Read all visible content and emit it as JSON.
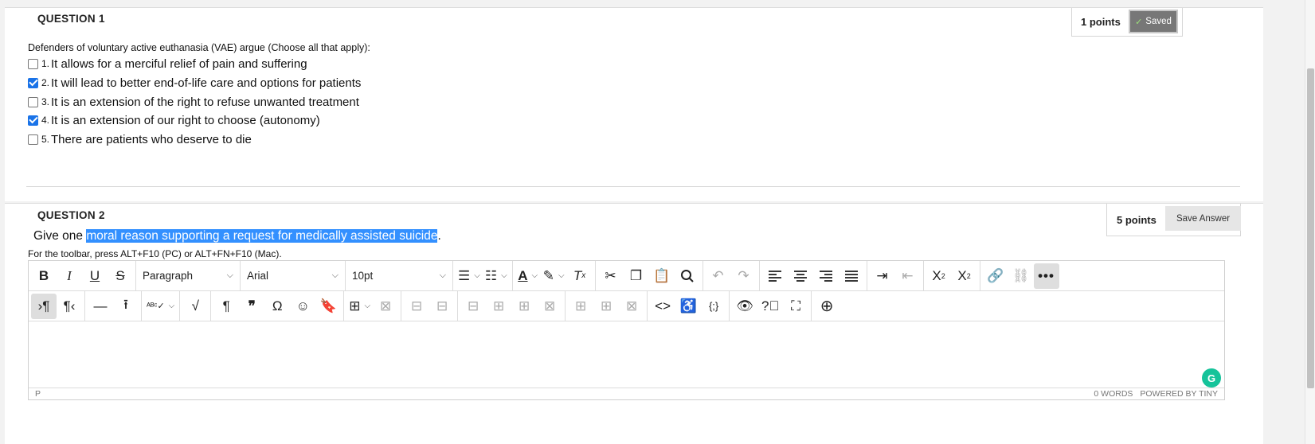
{
  "question1": {
    "title": "QUESTION 1",
    "points": "1 points",
    "saved_label": "Saved",
    "prompt": "Defenders of voluntary active euthanasia (VAE) argue (Choose all that apply):",
    "options": [
      {
        "num": "1.",
        "text": "It allows for a merciful relief of pain and suffering",
        "checked": false
      },
      {
        "num": "2.",
        "text": "It will lead to better end-of-life care and options for patients",
        "checked": true
      },
      {
        "num": "3.",
        "text": "It is an extension of the right to refuse unwanted treatment",
        "checked": false
      },
      {
        "num": "4.",
        "text": "It is an extension of our right to choose (autonomy)",
        "checked": true
      },
      {
        "num": "5.",
        "text": "There are patients who deserve to die",
        "checked": false
      }
    ]
  },
  "question2": {
    "title": "QUESTION 2",
    "points": "5 points",
    "save_label": "Save Answer",
    "text_plain": "Give one ",
    "text_selected": "moral reason supporting a request for medically assisted suicide",
    "text_after": ".",
    "toolbar_hint": "For the toolbar, press ALT+F10 (PC) or ALT+FN+F10 (Mac)."
  },
  "editor": {
    "block_format": "Paragraph",
    "font_family": "Arial",
    "font_size": "10pt",
    "status_path": "P",
    "word_count": "0 WORDS",
    "powered_by": "POWERED BY TINY",
    "grammarly_letter": "G"
  },
  "colors": {
    "selection": "#3390ff",
    "checkbox": "#1a73e8",
    "saved_button": "#777777",
    "grammarly": "#15c39a"
  }
}
